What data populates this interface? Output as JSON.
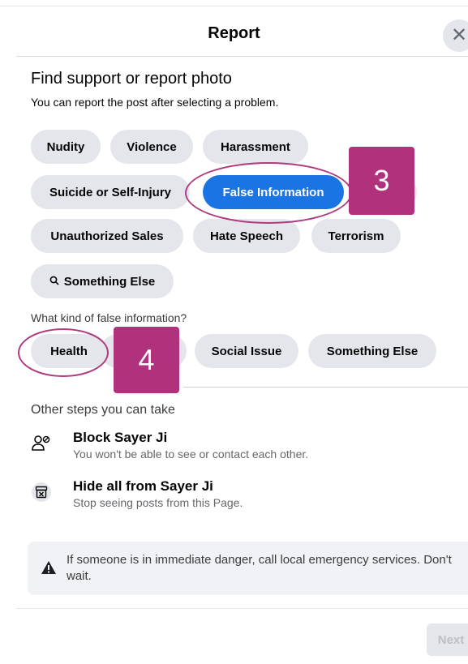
{
  "header": {
    "title": "Report",
    "close_symbol": "✕"
  },
  "intro": {
    "title": "Find support or report photo",
    "subtitle": "You can report the post after selecting a problem."
  },
  "problems": {
    "nudity": "Nudity",
    "violence": "Violence",
    "harassment": "Harassment",
    "suicide": "Suicide or Self-Injury",
    "false_info": "False Information",
    "unauthorized_sales": "Unauthorized Sales",
    "hate_speech": "Hate Speech",
    "terrorism": "Terrorism",
    "something_else": "Something Else",
    "something_else_icon": "search-icon",
    "selected": "False Information"
  },
  "false_info": {
    "question": "What kind of false information?",
    "options": {
      "health": "Health",
      "social_issue": "Social Issue",
      "something_else": "Something Else"
    }
  },
  "other_steps": {
    "title": "Other steps you can take",
    "block": {
      "title": "Block Sayer Ji",
      "desc": "You won't be able to see or contact each other.",
      "icon": "block-user-icon"
    },
    "hide": {
      "title": "Hide all from Sayer Ji",
      "desc": "Stop seeing posts from this Page.",
      "icon": "hide-all-icon"
    }
  },
  "notice": {
    "text": "If someone is in immediate danger, call local emergency services. Don't wait.",
    "icon": "warning-icon"
  },
  "footer": {
    "next": "Next"
  },
  "annotations": {
    "step3": "3",
    "step4": "4",
    "color": "#b0327c"
  },
  "colors": {
    "accent": "#1b74e4",
    "chip": "#e4e6eb",
    "annotation": "#b0327c"
  }
}
